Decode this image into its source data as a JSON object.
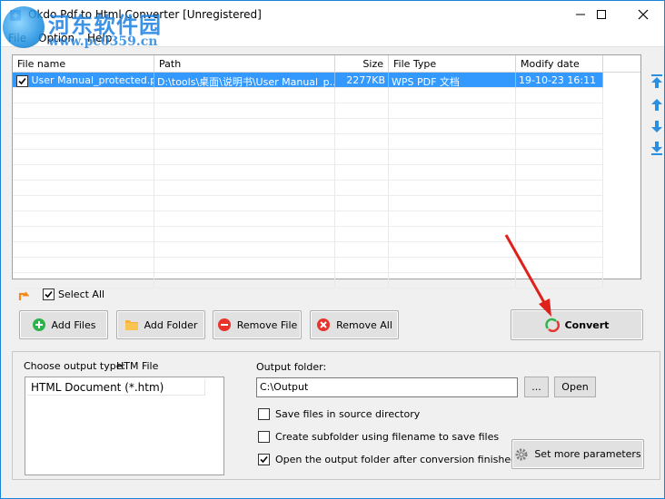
{
  "window": {
    "title": "Okdo Pdf to Html Converter [Unregistered]",
    "controls": {
      "minimize": "—",
      "maximize": "☐",
      "close": "✕"
    }
  },
  "watermark": {
    "site_name": "河东软件园",
    "url": "www.pc0359.cn"
  },
  "menu": {
    "items": [
      "File",
      "Option",
      "Help"
    ]
  },
  "filelist": {
    "columns": [
      "File name",
      "Path",
      "Size",
      "File Type",
      "Modify date"
    ],
    "rows": [
      {
        "checked": true,
        "name": "User Manual_protected.pdf",
        "path": "D:\\tools\\桌面\\说明书\\User Manual_p...",
        "size": "2277KB",
        "type": "WPS PDF 文档",
        "date": "19-10-23 16:11"
      }
    ]
  },
  "side_arrows": [
    "move-top",
    "move-up",
    "move-down",
    "move-bottom"
  ],
  "select_all": {
    "label": "Select All",
    "checked": true
  },
  "buttons": {
    "add_files": "Add Files",
    "add_folder": "Add Folder",
    "remove_file": "Remove File",
    "remove_all": "Remove All",
    "convert": "Convert"
  },
  "output": {
    "type_label": "Choose output type:",
    "type_value": "HTM File",
    "types": [
      "HTML Document (*.htm)"
    ],
    "folder_label": "Output folder:",
    "folder_value": "C:\\Output",
    "browse": "...",
    "open": "Open",
    "options": [
      {
        "label": "Save files in source directory",
        "checked": false
      },
      {
        "label": "Create subfolder using filename to save files",
        "checked": false
      },
      {
        "label": "Open the output folder after conversion finished",
        "checked": true
      }
    ],
    "more_params": "Set more parameters"
  },
  "colors": {
    "accent": "#1883d7",
    "selection": "#3399ff",
    "annotation_arrow": "#e0201b"
  }
}
